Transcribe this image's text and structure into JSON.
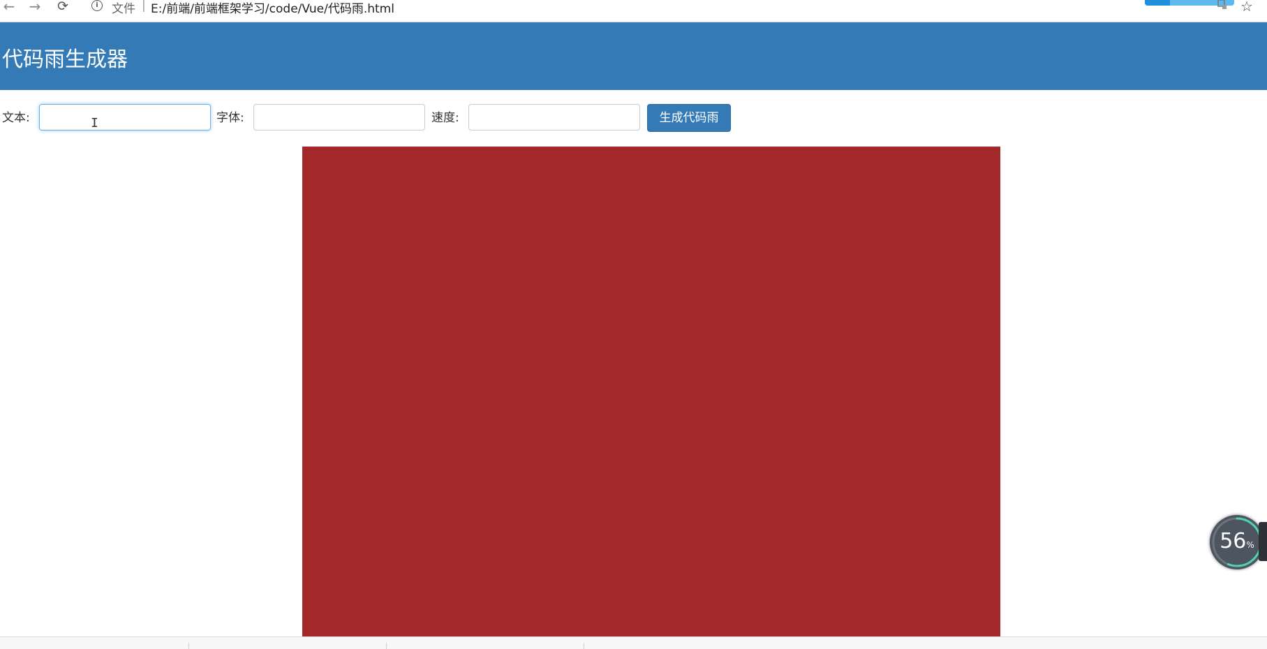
{
  "browser": {
    "back_icon": "←",
    "forward_icon": "→",
    "reload_icon": "⟳",
    "info_icon": "i",
    "url_label": "文件",
    "url_separator": "|",
    "url": "E:/前端/前端框架学习/code/Vue/代码雨.html",
    "star_icon": "☆"
  },
  "header": {
    "title": "代码雨生成器",
    "background_color": "#337ab7"
  },
  "form": {
    "text_label": "文本:",
    "text_value": "",
    "font_label": "字体:",
    "font_value": "",
    "speed_label": "速度:",
    "speed_value": "",
    "generate_button": "生成代码雨"
  },
  "canvas": {
    "background_color": "#a3282a"
  },
  "progress_widget": {
    "value": "56",
    "unit": "%",
    "fraction": 0.56
  }
}
